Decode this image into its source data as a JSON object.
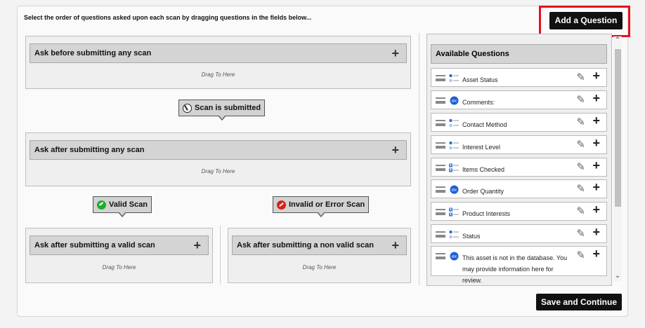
{
  "instructions": "Select the order of questions asked upon each scan by dragging questions in the fields below...",
  "add_question_label": "Add a Question",
  "save_continue_label": "Save and Continue",
  "drag_to_here": "Drag To Here",
  "zones": {
    "before": "Ask before submitting any scan",
    "after": "Ask after submitting any scan",
    "valid": "Ask after submitting a valid scan",
    "invalid": "Ask after submitting a non valid scan"
  },
  "callouts": {
    "submitted": "Scan is submitted",
    "valid": "Valid Scan",
    "invalid": "Invalid or Error Scan"
  },
  "available": {
    "title": "Available Questions",
    "questions": [
      {
        "label": "Asset Status",
        "icon": "list-radio-icon"
      },
      {
        "label": "Comments:",
        "icon": "text-bubble-icon"
      },
      {
        "label": "Contact Method",
        "icon": "list-radio-icon"
      },
      {
        "label": "Interest Level",
        "icon": "list-radio-icon"
      },
      {
        "label": "Items Checked",
        "icon": "list-checkbox-icon"
      },
      {
        "label": "Order Quantity",
        "icon": "text-bubble-icon"
      },
      {
        "label": "Product Interests",
        "icon": "list-checkbox-icon"
      },
      {
        "label": "Status",
        "icon": "list-radio-icon"
      },
      {
        "label": "This asset is not in the database. You may provide information here for review.",
        "icon": "text-bubble-icon"
      }
    ]
  },
  "colors": {
    "valid": "#1fae2e",
    "invalid": "#d8201b",
    "bubble": "#1b5fd6",
    "highlight": "#e0141f"
  }
}
